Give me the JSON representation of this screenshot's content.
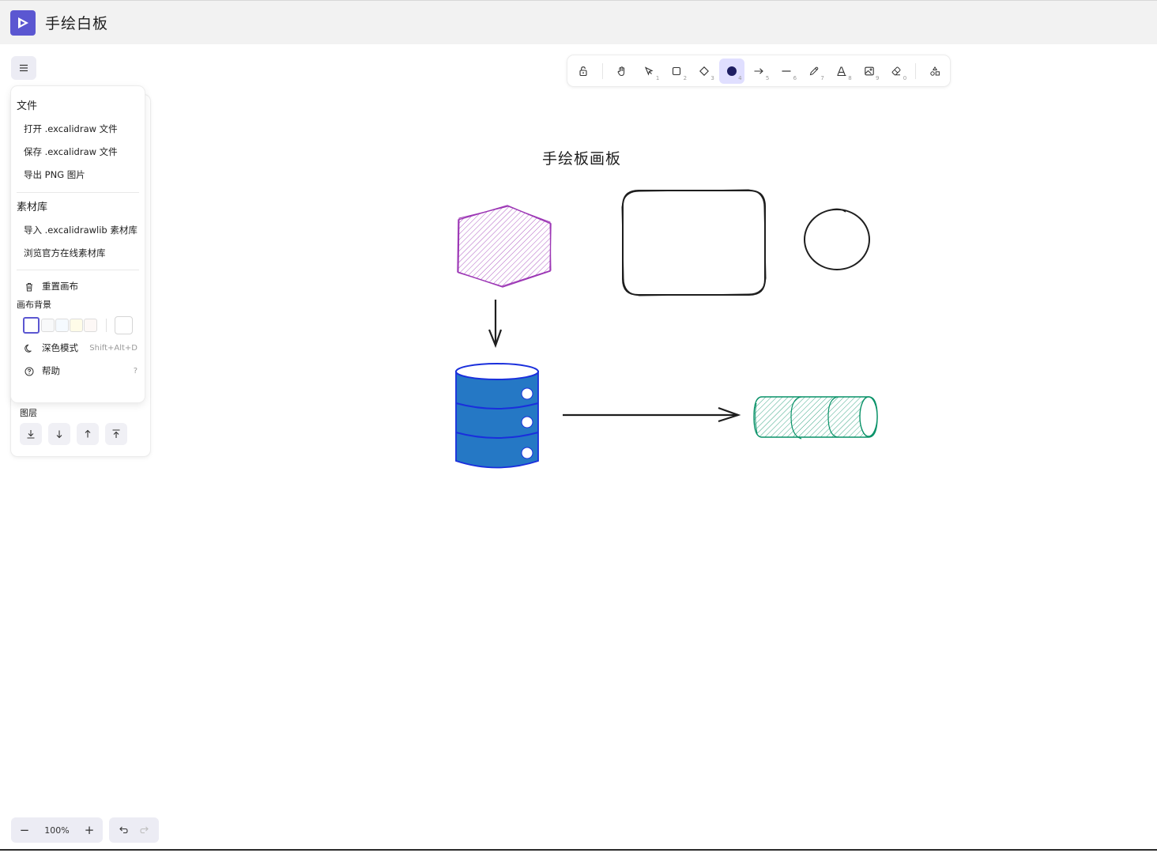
{
  "app": {
    "title": "手绘白板"
  },
  "main_menu": {
    "file_heading": "文件",
    "open_file": "打开 .excalidraw 文件",
    "save_file": "保存 .excalidraw 文件",
    "export_png": "导出 PNG 图片",
    "library_heading": "素材库",
    "import_library": "导入 .excalidrawlib 素材库",
    "browse_library": "浏览官方在线素材库",
    "reset_canvas": "重置画布",
    "canvas_bg_heading": "画布背景",
    "bg_swatches": [
      "#ffffff",
      "#f8f9fa",
      "#f5faff",
      "#fffce8",
      "#fdf8f6"
    ],
    "dark_mode": "深色模式",
    "dark_mode_shortcut": "Shift+Alt+D",
    "help": "帮助",
    "help_shortcut": "?"
  },
  "properties_panel": {
    "layers_label": "图层"
  },
  "toolbar": {
    "tools": [
      {
        "name": "lock",
        "key": ""
      },
      {
        "name": "hand",
        "key": ""
      },
      {
        "name": "selection",
        "key": "1"
      },
      {
        "name": "rectangle",
        "key": "2"
      },
      {
        "name": "diamond",
        "key": "3"
      },
      {
        "name": "ellipse",
        "key": "4"
      },
      {
        "name": "arrow",
        "key": "5"
      },
      {
        "name": "line",
        "key": "6"
      },
      {
        "name": "draw",
        "key": "7"
      },
      {
        "name": "text",
        "key": "8"
      },
      {
        "name": "image",
        "key": "9"
      },
      {
        "name": "eraser",
        "key": "0"
      },
      {
        "name": "extra-tools",
        "key": ""
      }
    ],
    "active_tool": "ellipse"
  },
  "canvas": {
    "text_label": "手绘板画板",
    "colors": {
      "hexagon": "#9c36b5",
      "database": "#1971c2",
      "database_stroke": "#1a2fdc",
      "cylinder": "#099268"
    }
  },
  "footer": {
    "zoom_level": "100%",
    "zoom_out": "−",
    "zoom_in": "+"
  },
  "theme": {
    "accent": "#5b57d1",
    "accent_light": "#e0dfff"
  }
}
